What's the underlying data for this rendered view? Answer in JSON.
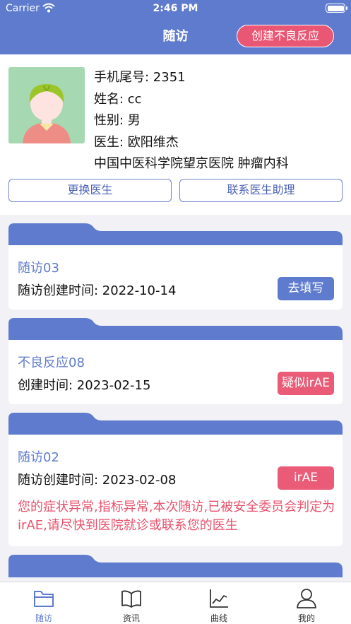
{
  "status_bar": {
    "carrier": "Carrier",
    "time": "2:46 PM"
  },
  "nav": {
    "title": "随访",
    "create_button": "创建不良反应"
  },
  "patient": {
    "phone_tail": "手机尾号: 2351",
    "name": "姓名: cc",
    "gender": "性别: 男",
    "doctor": "医生: 欧阳维杰",
    "hospital": "中国中医科学院望京医院 肿瘤内科",
    "change_doctor": "更换医生",
    "contact_assistant": "联系医生助理"
  },
  "cards": [
    {
      "title": "随访03",
      "line": "随访创建时间: 2022-10-14",
      "button": "去填写",
      "button_color": "#5f7bcd"
    },
    {
      "title": "不良反应08",
      "line": "创建时间: 2023-02-15",
      "button": "疑似irAE",
      "button_color": "#ea5b77"
    },
    {
      "title": "随访02",
      "line": "随访创建时间: 2023-02-08",
      "button": "irAE",
      "button_color": "#ea5b77",
      "warning": "您的症状异常,指标异常,本次随访,已被安全委员会判定为irAE,请尽快到医院就诊或联系您的医生"
    }
  ],
  "tabbar": [
    {
      "label": "随访",
      "icon": "folder-icon",
      "active": true
    },
    {
      "label": "资讯",
      "icon": "book-icon",
      "active": false
    },
    {
      "label": "曲线",
      "icon": "chart-icon",
      "active": false
    },
    {
      "label": "我的",
      "icon": "person-icon",
      "active": false
    }
  ],
  "colors": {
    "primary": "#5f7bcd",
    "alert": "#e95774",
    "avatar_bg": "#a6d8b2"
  }
}
